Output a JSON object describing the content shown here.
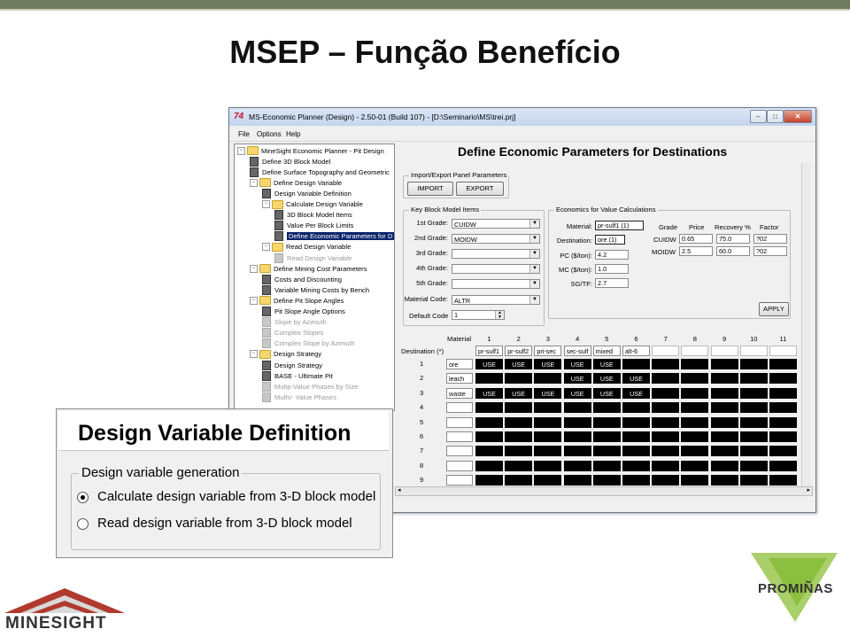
{
  "slide": {
    "title": "MSEP – Função Benefício"
  },
  "window": {
    "title": "MS-Economic Planner (Design) - 2.50-01 (Build 107) - [D:\\Seminario\\MS\\trei.prj]",
    "app_icon": "74",
    "minimize": "–",
    "maximize": "□",
    "close": "✕",
    "menu": [
      "File",
      "Options",
      "Help"
    ]
  },
  "tree": {
    "items": [
      {
        "label": "MineSight Economic Planner - Pit Design",
        "icon": "folder"
      },
      {
        "label": "Define 3D Block Model",
        "icon": "doc"
      },
      {
        "label": "Define Surface Topography and Geometric",
        "icon": "doc"
      },
      {
        "label": "Define Design Variable",
        "icon": "folder"
      },
      {
        "label": "Design Variable Definition",
        "icon": "doc"
      },
      {
        "label": "Calculate Design Variable",
        "icon": "folder"
      },
      {
        "label": "3D Block Model Items",
        "icon": "doc"
      },
      {
        "label": "Value Per Block Limits",
        "icon": "doc"
      },
      {
        "label": "Define Economic Parameters for D",
        "icon": "doc",
        "selected": true
      },
      {
        "label": "Read Design Variable",
        "icon": "folder"
      },
      {
        "label": "Read Design Variable",
        "icon": "doc-grey",
        "dim": true
      },
      {
        "label": "Define Mining Cost Parameters",
        "icon": "folder"
      },
      {
        "label": "Costs and Discounting",
        "icon": "doc"
      },
      {
        "label": "Variable Mining Costs by Bench",
        "icon": "doc"
      },
      {
        "label": "Define Pit Slope Angles",
        "icon": "folder"
      },
      {
        "label": "Pit Slope Angle Options",
        "icon": "doc"
      },
      {
        "label": "Slope by Azimuth",
        "icon": "doc-grey",
        "dim": true
      },
      {
        "label": "Complex Slopes",
        "icon": "doc-grey",
        "dim": true
      },
      {
        "label": "Complex Slope by Azimuth",
        "icon": "doc-grey",
        "dim": true
      },
      {
        "label": "Design Strategy",
        "icon": "folder"
      },
      {
        "label": "Design Strategy",
        "icon": "doc"
      },
      {
        "label": "BASE - Ultimate Pit",
        "icon": "doc"
      },
      {
        "label": "Multp-Value Phases by Size",
        "icon": "doc-grey",
        "dim": true
      },
      {
        "label": "MultV- Value Phases",
        "icon": "doc-grey",
        "dim": true
      }
    ]
  },
  "panel": {
    "title": "Define Economic Parameters for Destinations",
    "import_export": {
      "label": "Import/Export Panel Parameters",
      "import": "IMPORT",
      "export": "EXPORT"
    },
    "key_items": {
      "label": "Key Block Model Items",
      "rows": [
        {
          "label": "1st Grade:",
          "value": "CUIDW"
        },
        {
          "label": "2nd Grade:",
          "value": "MOIDW"
        },
        {
          "label": "3rd Grade:",
          "value": ""
        },
        {
          "label": "4th Grade:",
          "value": ""
        },
        {
          "label": "5th Grade:",
          "value": ""
        },
        {
          "label": "Material Code:",
          "value": "ALTR"
        }
      ],
      "default_code_label": "Default Code",
      "default_code_value": "1"
    },
    "economics": {
      "label": "Economics for Value Calculations",
      "material_label": "Material:",
      "material_value": "pr-sulf1 (1)",
      "destination_label": "Destination:",
      "destination_value": "ore (1)",
      "pc_label": "PC ($/ton):",
      "pc_value": "4.2",
      "mc_label": "MC ($/ton):",
      "mc_value": "1.0",
      "sgtf_label": "SG/TF:",
      "sgtf_value": "2.7",
      "headers": [
        "Grade",
        "Price",
        "Recovery %",
        "Factor"
      ],
      "grades": [
        {
          "grade": "CUIDW",
          "price": "0.65",
          "recovery": "75.0",
          "factor": "?02"
        },
        {
          "grade": "MOIDW",
          "price": "2.5",
          "recovery": "60.0",
          "factor": "?02"
        }
      ],
      "apply": "APPLY"
    },
    "grid": {
      "material_label": "Material",
      "destination_label": "Destination (*)",
      "col_numbers": [
        "1",
        "2",
        "3",
        "4",
        "5",
        "6",
        "7",
        "8",
        "9",
        "10",
        "11"
      ],
      "materials": [
        "pr-sulf1",
        "pr-sulf2",
        "pri-sec",
        "sec-sulf",
        "mixed",
        "alt-6",
        "",
        "",
        "",
        "",
        ""
      ],
      "rows": [
        {
          "num": "1",
          "name": "ore",
          "cells": [
            "USE",
            "USE",
            "USE",
            "USE",
            "USE",
            "",
            "",
            "",
            "",
            "",
            ""
          ]
        },
        {
          "num": "2",
          "name": "leach",
          "cells": [
            "",
            "",
            "",
            "USE",
            "USE",
            "USE",
            "",
            "",
            "",
            "",
            ""
          ]
        },
        {
          "num": "3",
          "name": "waste",
          "cells": [
            "USE",
            "USE",
            "USE",
            "USE",
            "USE",
            "USE",
            "",
            "",
            "",
            "",
            ""
          ]
        },
        {
          "num": "4",
          "name": "",
          "cells": [
            "",
            "",
            "",
            "",
            "",
            "",
            "",
            "",
            "",
            "",
            ""
          ]
        },
        {
          "num": "5",
          "name": "",
          "cells": [
            "",
            "",
            "",
            "",
            "",
            "",
            "",
            "",
            "",
            "",
            ""
          ]
        },
        {
          "num": "6",
          "name": "",
          "cells": [
            "",
            "",
            "",
            "",
            "",
            "",
            "",
            "",
            "",
            "",
            ""
          ]
        },
        {
          "num": "7",
          "name": "",
          "cells": [
            "",
            "",
            "",
            "",
            "",
            "",
            "",
            "",
            "",
            "",
            ""
          ]
        },
        {
          "num": "8",
          "name": "",
          "cells": [
            "",
            "",
            "",
            "",
            "",
            "",
            "",
            "",
            "",
            "",
            ""
          ]
        },
        {
          "num": "9",
          "name": "",
          "cells": [
            "",
            "",
            "",
            "",
            "",
            "",
            "",
            "",
            "",
            "",
            ""
          ]
        }
      ]
    }
  },
  "overlay": {
    "title": "Design Variable Definition",
    "group_label": "Design variable generation",
    "option1": "Calculate design variable from 3-D block model",
    "option2": "Read design variable from 3-D block model",
    "selected": 1
  },
  "logos": {
    "left": "MINESIGHT",
    "right": "PROMIÑAS"
  },
  "colors": {
    "topbar": "#6f7b5f",
    "titlebar": "#c3d5ee",
    "selection": "#0a246a",
    "grid_black": "#000000",
    "minesight_red": "#b03a2e",
    "prominas_green": "#8cbf3f"
  }
}
